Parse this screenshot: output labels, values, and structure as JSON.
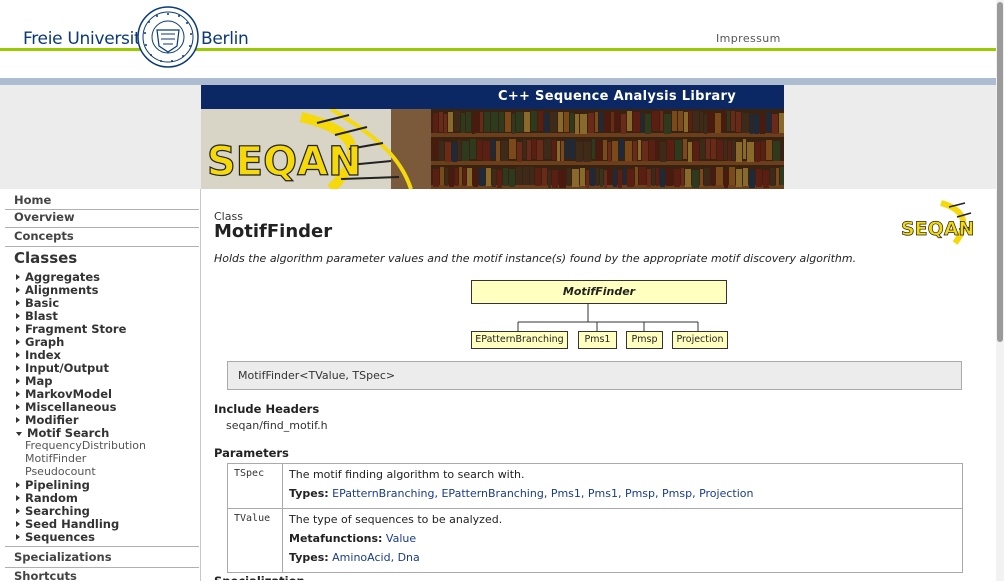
{
  "header": {
    "university_left": "Freie Universität",
    "university_right": "Berlin",
    "impressum": "Impressum"
  },
  "banner": {
    "title": "C++ Sequence Analysis Library",
    "logo_text": "SEQAN"
  },
  "sidebar": {
    "top_links": [
      "Home",
      "Overview",
      "Concepts"
    ],
    "classes_heading": "Classes",
    "items": [
      {
        "label": "Aggregates"
      },
      {
        "label": "Alignments"
      },
      {
        "label": "Basic"
      },
      {
        "label": "Blast"
      },
      {
        "label": "Fragment Store"
      },
      {
        "label": "Graph"
      },
      {
        "label": "Index"
      },
      {
        "label": "Input/Output"
      },
      {
        "label": "Map"
      },
      {
        "label": "MarkovModel"
      },
      {
        "label": "Miscellaneous"
      },
      {
        "label": "Modifier"
      },
      {
        "label": "Motif Search"
      },
      {
        "label": "FrequencyDistribution"
      },
      {
        "label": "MotifFinder"
      },
      {
        "label": "Pseudocount"
      },
      {
        "label": "Pipelining"
      },
      {
        "label": "Random"
      },
      {
        "label": "Searching"
      },
      {
        "label": "Seed Handling"
      },
      {
        "label": "Sequences"
      }
    ],
    "bottom_links": [
      "Specializations",
      "Shortcuts"
    ]
  },
  "main": {
    "kind": "Class",
    "name": "MotifFinder",
    "description": "Holds the algorithm parameter values and the motif instance(s) found by the appropriate motif discovery algorithm.",
    "diagram": {
      "root": "MotifFinder",
      "children": [
        "EPatternBranching",
        "Pms1",
        "Pmsp",
        "Projection"
      ]
    },
    "signature": "MotifFinder<TValue, TSpec>",
    "include_heading": "Include Headers",
    "include_value": "seqan/find_motif.h",
    "params_heading": "Parameters",
    "params": [
      {
        "name": "TSpec",
        "description": "The motif finding algorithm to search with.",
        "types_label": "Types:",
        "types": "EPatternBranching, EPatternBranching, Pms1, Pms1, Pmsp, Pmsp, Projection"
      },
      {
        "name": "TValue",
        "description": "The type of sequences to be analyzed.",
        "metafunctions_label": "Metafunctions:",
        "metafunctions": "Value",
        "types_label": "Types:",
        "types": "AminoAcid, Dna"
      }
    ],
    "next_heading": "Specialization"
  },
  "colors": {
    "navy": "#0c2864",
    "green_line": "#99cc00",
    "diagram_fill": "#ffffc0",
    "link": "#1a3c8c",
    "logo_yellow": "#f5d90a"
  }
}
